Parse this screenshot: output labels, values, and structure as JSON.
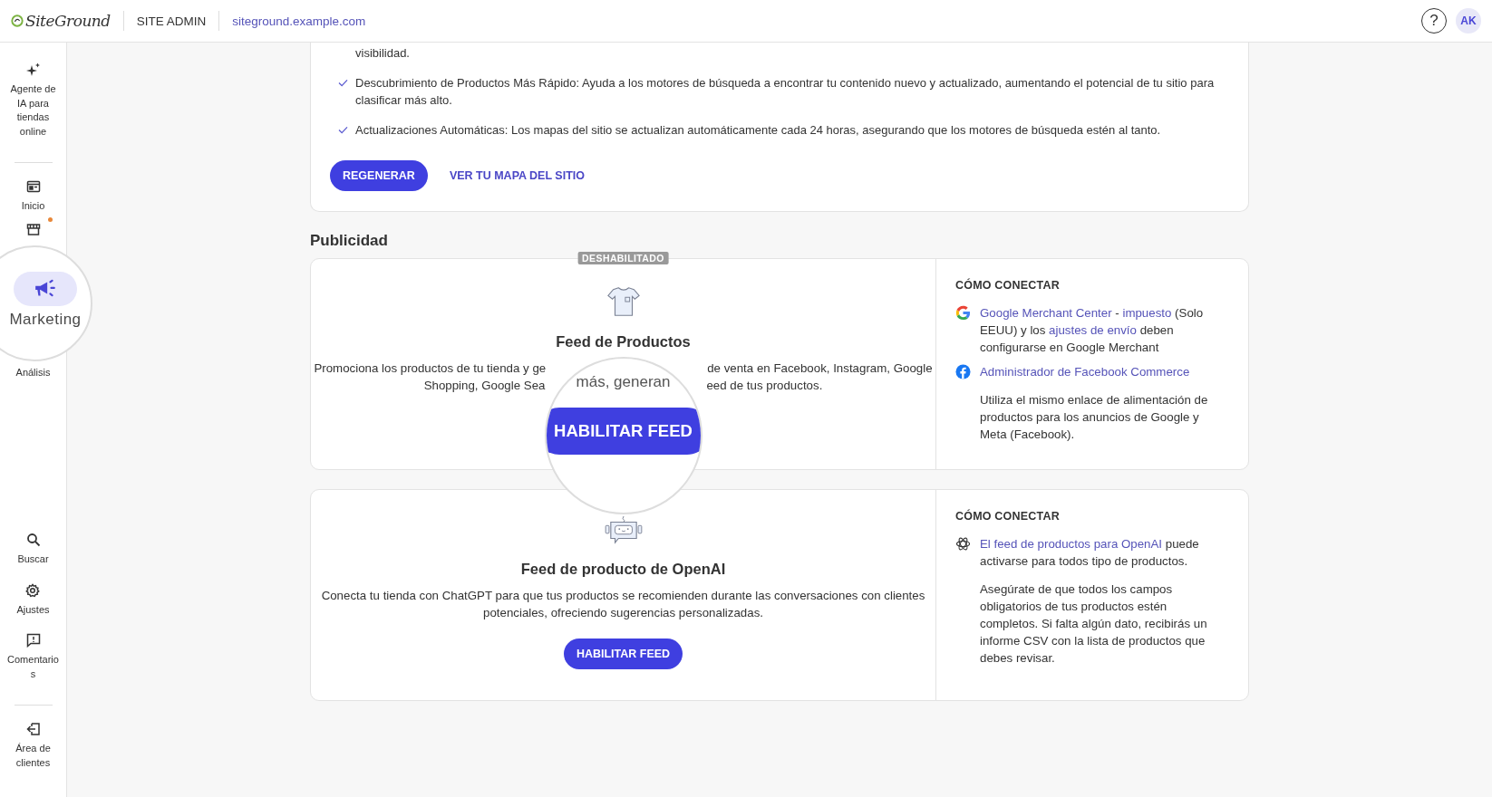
{
  "header": {
    "logo": "SiteGround",
    "section": "SITE ADMIN",
    "domain": "siteground.example.com",
    "help": "?",
    "avatar": "AK"
  },
  "sidebar": {
    "top": [
      {
        "label": "Agente de IA para tiendas online",
        "selected": false,
        "kind": "normal"
      },
      {
        "label": "Inicio",
        "selected": false,
        "kind": "normal"
      },
      {
        "selected": false,
        "kind": "icon_only",
        "notification": true
      },
      {
        "label": "Marketing",
        "selected": true,
        "kind": "magnified"
      },
      {
        "label": "Análisis",
        "selected": false,
        "kind": "label_only"
      }
    ],
    "bottom": [
      {
        "label": "Buscar",
        "selected": false
      },
      {
        "label": "Ajustes",
        "selected": false
      },
      {
        "label": "Comentarios",
        "selected": false
      },
      {
        "label": "Área de clientes",
        "selected": false
      }
    ]
  },
  "sitemap": {
    "items": [
      {
        "kind": "continuation",
        "text": "visibilidad."
      },
      {
        "kind": "check",
        "text": "Descubrimiento de Productos Más Rápido: Ayuda a los motores de búsqueda a encontrar tu contenido nuevo y actualizado, aumentando el potencial de tu sitio para clasificar más alto."
      },
      {
        "kind": "check",
        "text": "Actualizaciones Automáticas: Los mapas del sitio se actualizan automáticamente cada 24 horas, asegurando que los motores de búsqueda estén al tanto."
      }
    ],
    "primary_button": "REGENERAR",
    "link": "VER TU MAPA DEL SITIO"
  },
  "section_title": "Publicidad",
  "cards": [
    {
      "badge": "DESHABILITADO",
      "title": "Feed de Productos",
      "description_lines": [
        [
          "Promociona los productos de tu tienda y ge",
          "de venta en Facebook, Instagram, Google"
        ],
        [
          "Shopping, Google Sea",
          "eed de tus productos."
        ]
      ],
      "magnifier": {
        "text": "más, generan",
        "button": "HABILITAR FEED"
      },
      "connect": {
        "heading": "CÓMO CONECTAR",
        "entries": [
          {
            "parts": [
              {
                "text": "Google Merchant Center",
                "kind": "link"
              },
              {
                "text": " - ",
                "kind": "text"
              },
              {
                "text": "impuesto",
                "kind": "link"
              },
              {
                "text": " (Solo EEUU) y los ",
                "kind": "text"
              },
              {
                "text": "ajustes de envío",
                "kind": "link"
              },
              {
                "text": " deben configurarse en Google Merchant",
                "kind": "text"
              }
            ]
          },
          {
            "parts": [
              {
                "text": "Administrador de Facebook Commerce",
                "kind": "link"
              }
            ]
          }
        ],
        "note": "Utiliza el mismo enlace de alimentación de productos para los anuncios de Google y Meta (Facebook)."
      }
    },
    {
      "title": "Feed de producto de OpenAI",
      "description_lines": [
        [
          "Conecta tu tienda con ChatGPT para que tus productos se recomienden durante las conversaciones con clientes"
        ],
        [
          "potenciales, ofreciendo sugerencias personalizadas."
        ]
      ],
      "button": "HABILITAR FEED",
      "connect": {
        "heading": "CÓMO CONECTAR",
        "entries": [
          {
            "parts": [
              {
                "text": "El feed de productos para OpenAI",
                "kind": "link"
              },
              {
                "text": " puede activarse para todos tipo de productos.",
                "kind": "text"
              }
            ]
          }
        ],
        "note": "Asegúrate de que todos los campos obligatorios de tus productos estén completos. Si falta algún dato, recibirás un informe CSV con la lista de productos que debes revisar."
      }
    }
  ]
}
